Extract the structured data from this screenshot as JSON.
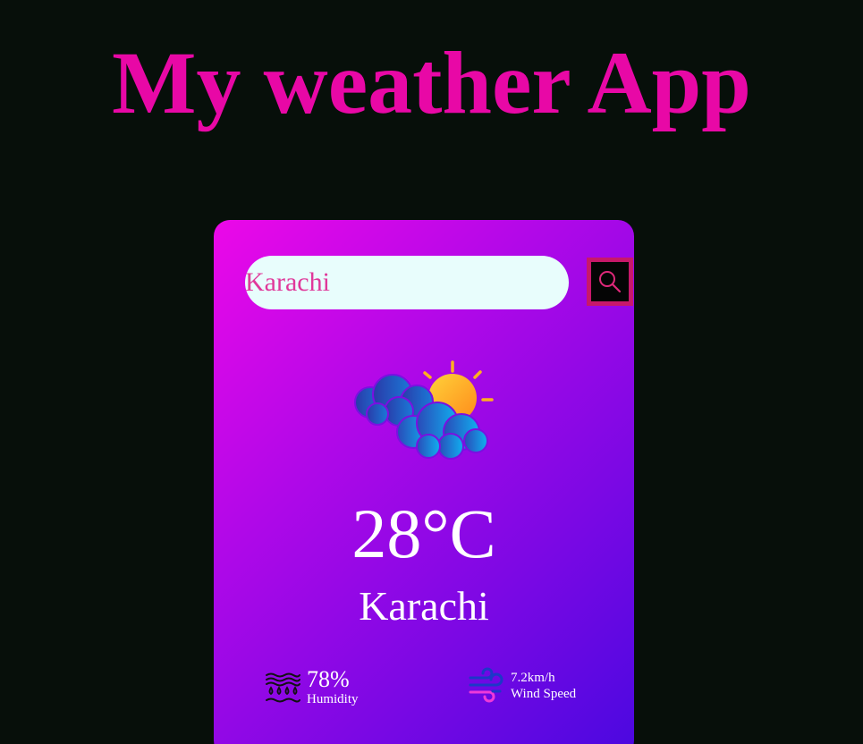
{
  "app": {
    "title": "My weather App"
  },
  "search": {
    "value": "Karachi",
    "placeholder": "",
    "button_icon": "search-icon"
  },
  "weather": {
    "icon": "partly-cloudy-icon",
    "temperature": "28°C",
    "city": "Karachi"
  },
  "details": {
    "humidity": {
      "icon": "humidity-icon",
      "value": "78%",
      "label": "Humidity"
    },
    "wind": {
      "icon": "wind-icon",
      "value": "7.2km/h",
      "label": "Wind Speed"
    }
  },
  "colors": {
    "background": "#070f0a",
    "title": "#e808a6",
    "card_gradient_start": "#ec08e8",
    "card_gradient_end": "#4a08e0",
    "search_border": "#c8186a",
    "input_background": "#e8fdfc",
    "input_text": "#e0389a"
  }
}
